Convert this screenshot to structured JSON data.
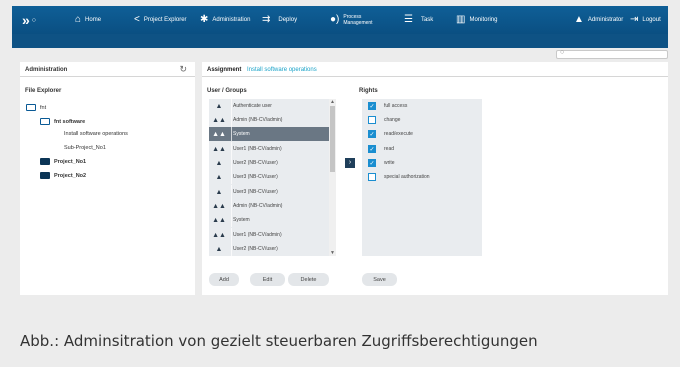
{
  "nav": {
    "home": "Home",
    "project_explorer": "Project Explorer",
    "administration": "Administration",
    "deploy": "Deploy",
    "process_management_1": "Process",
    "process_management_2": "Management",
    "task": "Task",
    "monitoring": "Monitoring",
    "user": "Administrator",
    "logout": "Logout"
  },
  "left_panel": {
    "title": "Administration",
    "file_explorer": "File Explorer",
    "tree": [
      "fnt",
      "fnt software",
      "Install software operations",
      "Sub-Project_No1",
      "Project_No1",
      "Project_No2"
    ]
  },
  "right_panel": {
    "tab_active": "Assignment",
    "tab_link": "Install software operations",
    "users_title": "User / Groups",
    "rights_title": "Rights",
    "users": [
      {
        "label": "Authenticate user",
        "icon": "user-icon"
      },
      {
        "label": "Admin (NB-CV/admin)",
        "icon": "group-icon"
      },
      {
        "label": "System",
        "icon": "group-icon",
        "selected": true
      },
      {
        "label": "User1 (NB-CV/admin)",
        "icon": "group-icon"
      },
      {
        "label": "User2 (NB-CV/user)",
        "icon": "user-icon"
      },
      {
        "label": "User3 (NB-CV/user)",
        "icon": "user-icon"
      },
      {
        "label": "User3 (NB-CV/user)",
        "icon": "user-icon"
      },
      {
        "label": "Admin (NB-CV/admin)",
        "icon": "group-icon"
      },
      {
        "label": "System",
        "icon": "group-icon"
      },
      {
        "label": "User1 (NB-CV/admin)",
        "icon": "group-icon"
      },
      {
        "label": "User2 (NB-CV/user)",
        "icon": "user-icon"
      }
    ],
    "rights": [
      {
        "label": "full access",
        "checked": true
      },
      {
        "label": "change",
        "checked": false
      },
      {
        "label": "read/execute",
        "checked": true
      },
      {
        "label": "read",
        "checked": true
      },
      {
        "label": "write",
        "checked": true
      },
      {
        "label": "special authorization",
        "checked": false
      }
    ],
    "buttons": {
      "add": "Add",
      "edit": "Edit",
      "delete": "Delete",
      "save": "Save"
    }
  },
  "caption": "Abb.: Adminsitration von gezielt steuerbaren Zugriffsberechtigungen"
}
